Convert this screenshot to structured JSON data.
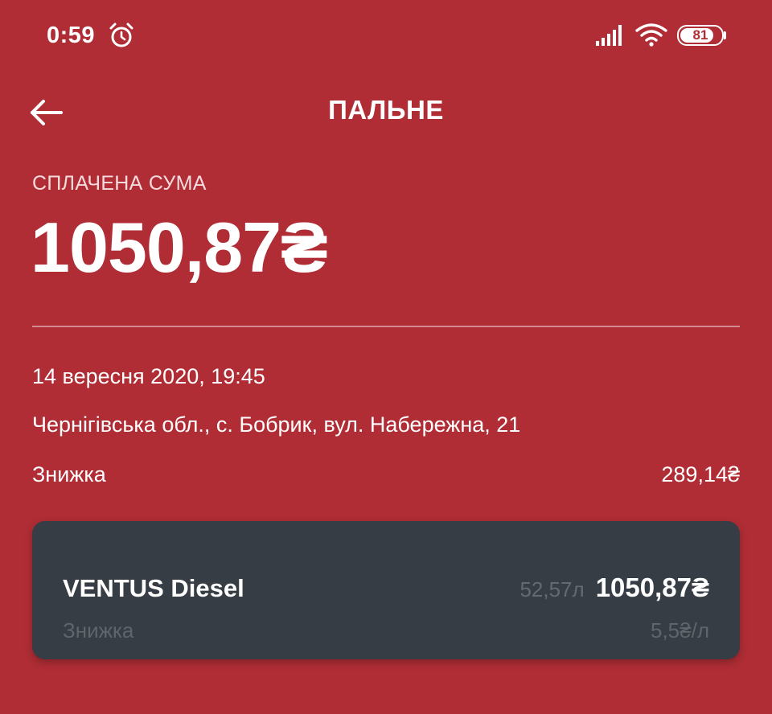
{
  "status_bar": {
    "time": "0:59",
    "battery_level": "81",
    "battery_fraction": 0.81
  },
  "header": {
    "title": "ПАЛЬНЕ",
    "back_icon": "arrow-left-icon"
  },
  "amount": {
    "label": "СПЛАЧЕНА СУМА",
    "value": "1050,87₴"
  },
  "details": {
    "date": "14 вересня 2020, 19:45",
    "address": "Чернігівська обл., с. Бобрик, вул. Набережна, 21",
    "discount_label": "Знижка",
    "discount_value": "289,14₴"
  },
  "fuel_item": {
    "name": "VENTUS Diesel",
    "volume": "52,57л",
    "price": "1050,87₴",
    "discount_label": "Знижка",
    "discount_value": "5,5₴/л"
  },
  "colors": {
    "background": "#b02d35",
    "card": "#363d44",
    "muted_text": "#5e656b"
  }
}
